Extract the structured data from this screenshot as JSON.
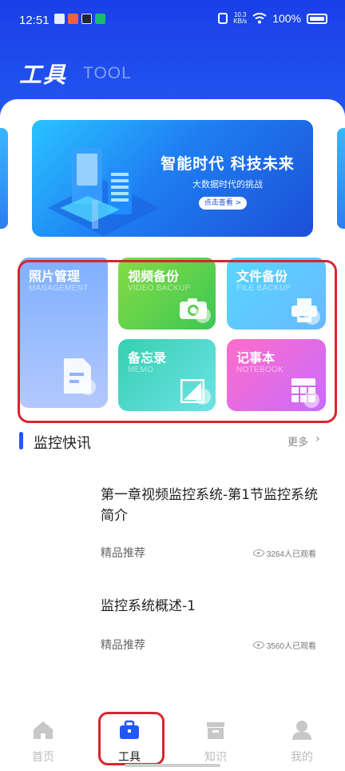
{
  "status_bar": {
    "time": "12:51",
    "net_speed_top": "10.3",
    "net_speed_bottom": "KB/s",
    "battery": "100%"
  },
  "header": {
    "title": "工具",
    "subtitle": "TOOL"
  },
  "banner": {
    "title": "智能时代 科技未来",
    "subtitle": "大数据时代的挑战",
    "button": "点击查看 >"
  },
  "tools": [
    {
      "label": "照片管理",
      "sub": "MANAGEMENT",
      "icon": "document-icon"
    },
    {
      "label": "视频备份",
      "sub": "VIDEO BACKUP",
      "icon": "camera-icon"
    },
    {
      "label": "文件备份",
      "sub": "FILE BACKUP",
      "icon": "printer-icon"
    },
    {
      "label": "备忘录",
      "sub": "MEMO",
      "icon": "memo-icon"
    },
    {
      "label": "记事本",
      "sub": "NOTEBOOK",
      "icon": "grid-icon"
    }
  ],
  "section": {
    "title": "监控快讯",
    "more": "更多",
    "chevron": "›"
  },
  "news": [
    {
      "title": "第一章视频监控系统-第1节监控系统简介",
      "tag": "精品推荐",
      "views": "3264人已观看"
    },
    {
      "title": "监控系统概述-1",
      "tag": "精品推荐",
      "views": "3560人已观看"
    }
  ],
  "tabs": [
    {
      "label": "首页",
      "icon": "home-icon",
      "active": false
    },
    {
      "label": "工具",
      "icon": "toolbox-icon",
      "active": true
    },
    {
      "label": "知识",
      "icon": "box-icon",
      "active": false
    },
    {
      "label": "我的",
      "icon": "user-icon",
      "active": false
    }
  ],
  "colors": {
    "primary": "#2357f0",
    "highlight": "#d9252f"
  }
}
